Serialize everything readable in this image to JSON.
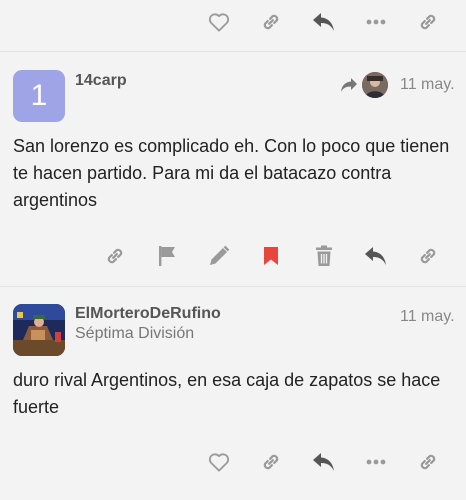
{
  "posts": [
    {
      "username": "14carp",
      "avatar_letter": "1",
      "date": "11 may.",
      "body": "San lorenzo es complicado eh. Con lo poco que tienen te hacen partido. Para mi da el batacazo contra argentinos",
      "reply_indicator": "reply-to-user"
    },
    {
      "username": "ElMorteroDeRufino",
      "user_title": "Séptima División",
      "date": "11 may.",
      "body": "duro rival Argentinos, en esa caja de zapatos se hace fuerte"
    }
  ],
  "colors": {
    "icon": "#9a9a9a",
    "icon_dark": "#555555",
    "bookmark_active": "#e8453c",
    "avatar_bg": "#9ea4e6"
  },
  "icons": {
    "top_actions": [
      "heart-icon",
      "link-icon",
      "reply-icon",
      "more-icon",
      "link-icon"
    ],
    "post1_actions": [
      "link-icon",
      "flag-icon",
      "edit-icon",
      "bookmark-icon",
      "delete-icon",
      "reply-icon",
      "link-icon"
    ],
    "post2_actions": [
      "heart-icon",
      "link-icon",
      "reply-icon",
      "more-icon",
      "link-icon"
    ]
  }
}
